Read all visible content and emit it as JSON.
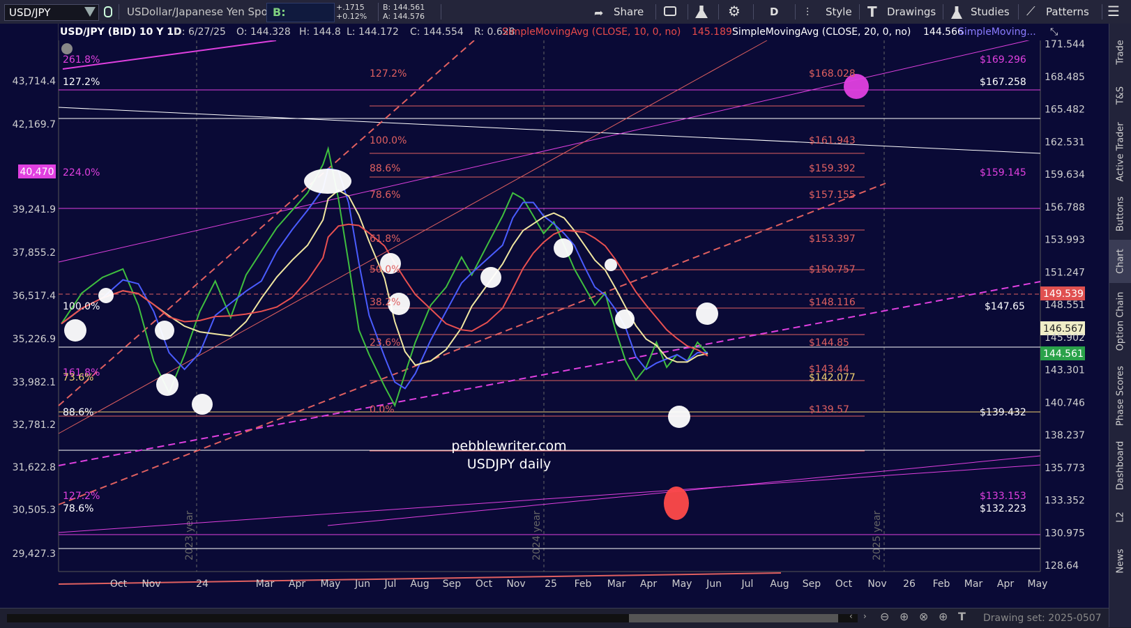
{
  "toolbar": {
    "symbol": "USD/JPY",
    "description": "USDollar/Japanese Yen Spot",
    "bid_label": "B: 144.561",
    "change": "+.1715",
    "change_pct": "+0.12%",
    "bid_small": "B: 144.561",
    "ask_small": "A: 144.576",
    "share": "Share",
    "style": "Style",
    "drawings": "Drawings",
    "studies": "Studies",
    "patterns": "Patterns",
    "timeframe": "D"
  },
  "header": {
    "title": "USD/JPY (BID) 10 Y 1D",
    "date": "D: 6/27/25",
    "open": "O: 144.328",
    "high": "H: 144.8",
    "low": "L: 144.172",
    "close": "C: 144.554",
    "range": "R: 0.628",
    "sma10": "SimpleMovingAvg (CLOSE, 10, 0, no)",
    "sma10_val": "145.189",
    "sma20": "SimpleMovingAvg (CLOSE, 20, 0, no)",
    "sma20_val": "144.566",
    "sma_more": "SimpleMoving..."
  },
  "right_tabs": [
    "Trade",
    "T&S",
    "Active Trader",
    "Buttons",
    "Chart",
    "Option Chain",
    "Phase Scores",
    "Dashboard",
    "L2",
    "News"
  ],
  "bottom": {
    "drawing_set": "Drawing set: 2025-0507"
  },
  "chart_data": {
    "type": "line",
    "title": "pebblewriter.com",
    "subtitle": "USDJPY daily",
    "right_axis_ticks": [
      "171.544",
      "168.485",
      "165.482",
      "162.531",
      "159.634",
      "156.788",
      "153.993",
      "151.247",
      "148.551",
      "145.902",
      "143.301",
      "140.746",
      "138.237",
      "135.773",
      "133.352",
      "130.975",
      "128.64"
    ],
    "left_axis_ticks": [
      "43,714.4",
      "42,169.7",
      "40,470",
      "39,241.9",
      "37,855.2",
      "36,517.4",
      "35,226.9",
      "33,982.1",
      "32,781.2",
      "31,622.8",
      "30,505.3",
      "29,427.3"
    ],
    "left_highlight": "40,470",
    "x_ticks": [
      "Oct",
      "Nov",
      "24",
      "Mar",
      "Apr",
      "May",
      "Jun",
      "Jul",
      "Aug",
      "Sep",
      "Oct",
      "Nov",
      "25",
      "Feb",
      "Mar",
      "Apr",
      "May",
      "Jun",
      "Jul",
      "Aug",
      "Sep",
      "Oct",
      "Nov",
      "26",
      "Feb",
      "Mar",
      "Apr",
      "May"
    ],
    "year_markers": [
      "2023 year",
      "2024 year",
      "2025 year"
    ],
    "price_badges": [
      {
        "label": "149.539",
        "color": "#e05050"
      },
      {
        "label": "146.567",
        "color": "#f0eec8"
      },
      {
        "label": "144.561",
        "color": "#2aa24a"
      }
    ],
    "fib_left_labels": [
      "261.8%",
      "127.2%",
      "224.0%",
      "100.0%",
      "161.8%",
      "73.6%",
      "88.6%",
      "127.2%",
      "78.6%"
    ],
    "fib_mid_labels": [
      "127.2%",
      "100.0%",
      "88.6%",
      "78.6%",
      "61.8%",
      "50.0%",
      "38.2%",
      "23.6%",
      "0.0%"
    ],
    "price_levels_red": [
      "$168.028",
      "$161.943",
      "$159.392",
      "$157.155",
      "$153.397",
      "$150.757",
      "$148.116",
      "$144.85",
      "$143.44",
      "$142.077",
      "$139.57"
    ],
    "price_levels_white": [
      "$167.258",
      "$159.145",
      "$147.65",
      "$139.432",
      "$133.153",
      "$132.223",
      "$169.296"
    ],
    "series": [
      {
        "name": "USD/JPY",
        "values": [
          [
            0,
            147.0
          ],
          [
            8,
            149.5
          ],
          [
            16,
            150.8
          ],
          [
            24,
            151.5
          ],
          [
            30,
            148.5
          ],
          [
            36,
            144.0
          ],
          [
            42,
            141.5
          ],
          [
            48,
            144.5
          ],
          [
            54,
            148.0
          ],
          [
            60,
            150.5
          ],
          [
            66,
            147.5
          ],
          [
            72,
            151.0
          ],
          [
            78,
            153.0
          ],
          [
            84,
            155.0
          ],
          [
            90,
            156.5
          ],
          [
            96,
            158.0
          ],
          [
            102,
            160.5
          ],
          [
            104,
            161.9
          ],
          [
            108,
            157.5
          ],
          [
            112,
            152.0
          ],
          [
            116,
            146.5
          ],
          [
            120,
            144.5
          ],
          [
            126,
            142.0
          ],
          [
            130,
            140.5
          ],
          [
            134,
            143.0
          ],
          [
            138,
            145.5
          ],
          [
            144,
            148.5
          ],
          [
            150,
            150.0
          ],
          [
            156,
            152.5
          ],
          [
            160,
            151.0
          ],
          [
            166,
            153.5
          ],
          [
            172,
            156.0
          ],
          [
            176,
            158.0
          ],
          [
            180,
            157.5
          ],
          [
            184,
            156.0
          ],
          [
            188,
            154.5
          ],
          [
            192,
            155.5
          ],
          [
            196,
            153.5
          ],
          [
            200,
            151.5
          ],
          [
            204,
            150.0
          ],
          [
            208,
            148.5
          ],
          [
            212,
            149.5
          ],
          [
            216,
            146.5
          ],
          [
            220,
            144.0
          ],
          [
            224,
            142.5
          ],
          [
            228,
            143.5
          ],
          [
            232,
            145.5
          ],
          [
            236,
            143.5
          ],
          [
            240,
            144.5
          ],
          [
            244,
            144.0
          ],
          [
            248,
            145.5
          ],
          [
            252,
            144.56
          ]
        ]
      }
    ]
  }
}
